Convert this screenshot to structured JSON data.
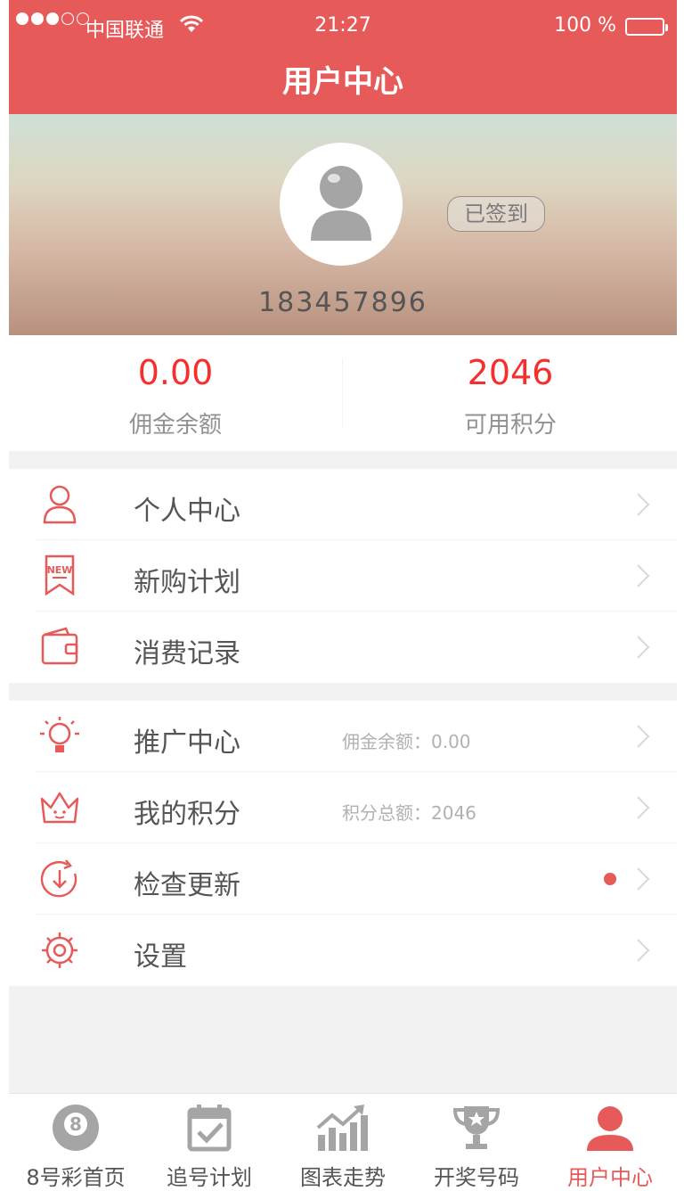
{
  "status_bar": {
    "carrier": "中国联通",
    "time": "21:27",
    "battery": "100 %",
    "signal_strength": 3,
    "signal_max": 5
  },
  "nav": {
    "title": "用户中心"
  },
  "profile": {
    "username": "183457896",
    "signin_label": "已签到",
    "avatar_icon": "user-avatar-icon"
  },
  "stats": {
    "commission_value": "0.00",
    "commission_label": "佣金余额",
    "points_value": "2046",
    "points_label": "可用积分"
  },
  "menu": {
    "group1": [
      {
        "label": "个人中心",
        "icon": "person-icon"
      },
      {
        "label": "新购计划",
        "icon": "new-ribbon-icon"
      },
      {
        "label": "消费记录",
        "icon": "wallet-icon"
      }
    ],
    "group2": [
      {
        "label": "推广中心",
        "icon": "lightbulb-icon",
        "aux": "佣金余额：0.00"
      },
      {
        "label": "我的积分",
        "icon": "crown-icon",
        "aux": "积分总额：2046"
      },
      {
        "label": "检查更新",
        "icon": "update-arrow-icon",
        "badge": true
      },
      {
        "label": "设置",
        "icon": "gear-icon"
      }
    ]
  },
  "tabbar": [
    {
      "label": "8号彩首页",
      "icon": "eight-ball-icon",
      "active": false
    },
    {
      "label": "追号计划",
      "icon": "calendar-check-icon",
      "active": false
    },
    {
      "label": "图表走势",
      "icon": "chart-trend-icon",
      "active": false
    },
    {
      "label": "开奖号码",
      "icon": "trophy-icon",
      "active": false
    },
    {
      "label": "用户中心",
      "icon": "user-icon",
      "active": true
    }
  ],
  "colors": {
    "brand": "#e65a59",
    "highlight_value": "#f42f2e",
    "text_primary": "#555555",
    "text_secondary": "#929292",
    "text_aux": "#b1b1b1",
    "divider": "#f3f3f3",
    "page_bg": "#f2f2f2",
    "signin_text": "#7c7c7c"
  }
}
